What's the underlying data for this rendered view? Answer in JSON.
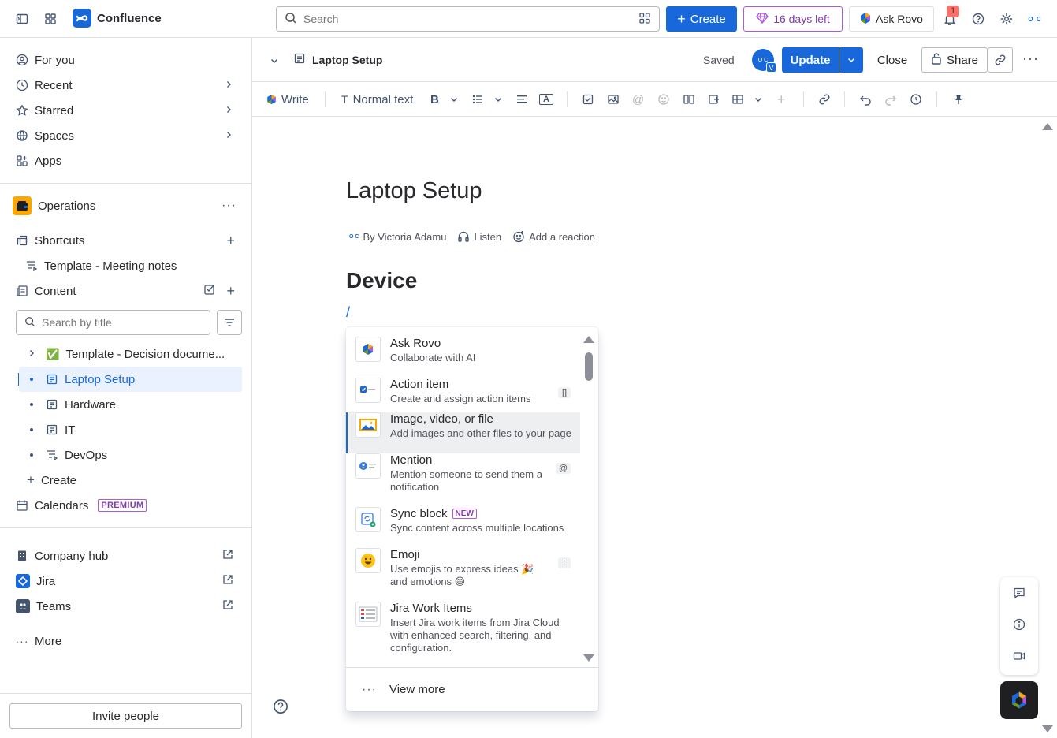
{
  "topbar": {
    "app_name": "Confluence",
    "search_placeholder": "Search",
    "create_label": "Create",
    "trial_label": "16 days left",
    "rovo_label": "Ask Rovo",
    "notification_count": "1",
    "avatar_initials": "O C"
  },
  "sidebar": {
    "nav": [
      {
        "label": "For you"
      },
      {
        "label": "Recent"
      },
      {
        "label": "Starred"
      },
      {
        "label": "Spaces"
      },
      {
        "label": "Apps"
      }
    ],
    "space_name": "Operations",
    "shortcuts_label": "Shortcuts",
    "shortcut_item": "Template - Meeting notes",
    "content_label": "Content",
    "search_placeholder": "Search by title",
    "tree": [
      {
        "label": "Template - Decision docume...",
        "emoji": "✅"
      },
      {
        "label": "Laptop Setup"
      },
      {
        "label": "Hardware"
      },
      {
        "label": "IT"
      },
      {
        "label": "DevOps"
      }
    ],
    "create_label": "Create",
    "calendars_label": "Calendars",
    "premium_label": "PREMIUM",
    "apps": [
      {
        "label": "Company hub"
      },
      {
        "label": "Jira"
      },
      {
        "label": "Teams"
      }
    ],
    "more_label": "More",
    "invite_label": "Invite people"
  },
  "page_header": {
    "title": "Laptop Setup",
    "status": "Saved",
    "avatar_initials": "O C",
    "avatar_badge": "V",
    "update_label": "Update",
    "close_label": "Close",
    "share_label": "Share"
  },
  "toolbar": {
    "write_label": "Write",
    "text_style": "Normal text"
  },
  "document": {
    "title": "Laptop Setup",
    "author": "By Victoria Adamu",
    "listen_label": "Listen",
    "reaction_label": "Add a reaction",
    "heading": "Device",
    "slash": "/"
  },
  "slash_menu": {
    "items": [
      {
        "title": "Ask Rovo",
        "desc": "Collaborate with AI",
        "icon": "rovo-icon",
        "key": ""
      },
      {
        "title": "Action item",
        "desc": "Create and assign action items",
        "icon": "checkbox-icon",
        "key": "[]"
      },
      {
        "title": "Image, video, or file",
        "desc": "Add images and other files to your page",
        "icon": "image-icon",
        "key": ""
      },
      {
        "title": "Mention",
        "desc": "Mention someone to send them a notification",
        "icon": "mention-icon",
        "key": "@"
      },
      {
        "title": "Sync block",
        "desc": "Sync content across multiple locations",
        "icon": "sync-icon",
        "key": "",
        "badge": "NEW"
      },
      {
        "title": "Emoji",
        "desc": "Use emojis to express ideas 🎉 and emotions 😄",
        "icon": "emoji-icon",
        "key": ":"
      },
      {
        "title": "Jira Work Items",
        "desc": "Insert Jira work items from Jira Cloud with enhanced search, filtering, and configuration.",
        "icon": "jira-list-icon",
        "key": ""
      }
    ],
    "view_more_label": "View more"
  },
  "colors": {
    "brand": "#1868DB",
    "premium": "#AF59E1",
    "selected_bg": "#E9F2FE"
  }
}
